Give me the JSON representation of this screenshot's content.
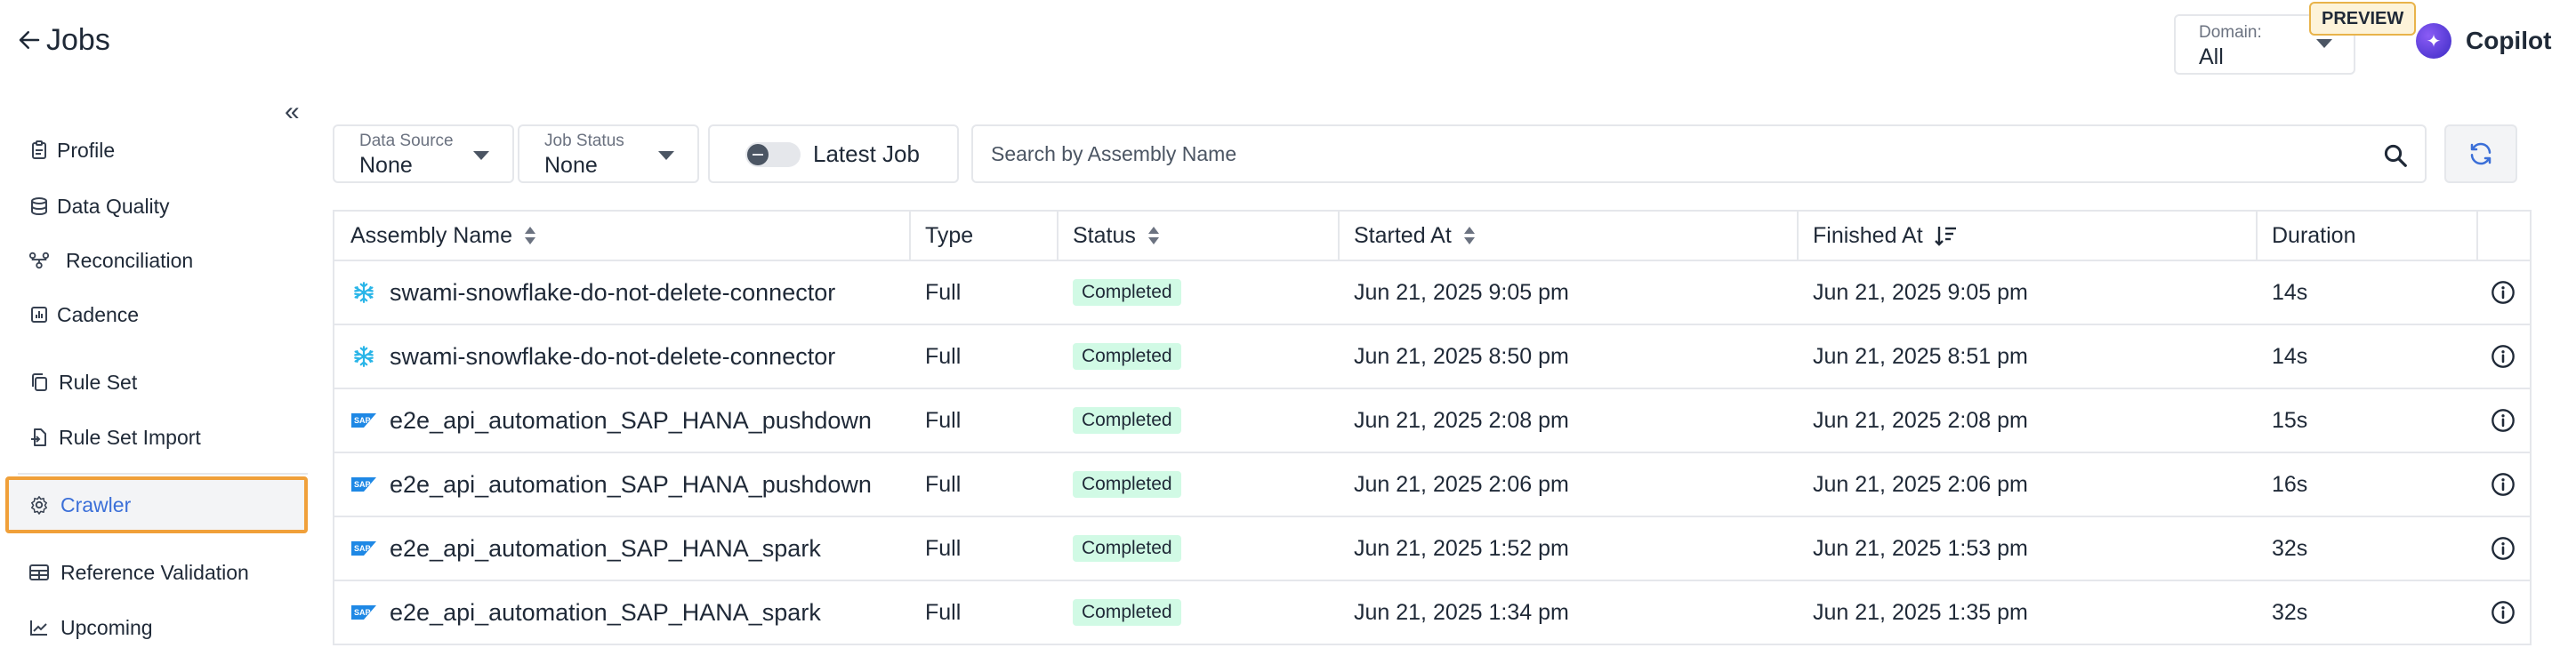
{
  "header": {
    "title": "Jobs",
    "domain": {
      "label": "Domain:",
      "value": "All"
    },
    "preview_badge": "PREVIEW",
    "copilot_label": "Copilot"
  },
  "sidebar": {
    "items": [
      {
        "label": "Profile",
        "icon": "clipboard-icon"
      },
      {
        "label": "Data Quality",
        "icon": "database-icon"
      },
      {
        "label": "Reconciliation",
        "icon": "reconciliation-icon"
      },
      {
        "label": "Cadence",
        "icon": "bar-chart-icon"
      },
      {
        "label": "Rule Set",
        "icon": "copy-icon"
      },
      {
        "label": "Rule Set Import",
        "icon": "file-import-icon"
      },
      {
        "label": "Crawler",
        "icon": "gear-icon",
        "active": true
      },
      {
        "label": "Reference Validation",
        "icon": "table-icon"
      },
      {
        "label": "Upcoming",
        "icon": "line-chart-icon"
      }
    ]
  },
  "filters": {
    "data_source": {
      "label": "Data Source",
      "value": "None"
    },
    "job_status": {
      "label": "Job Status",
      "value": "None"
    },
    "latest_job_label": "Latest Job",
    "latest_job_on": false,
    "search_placeholder": "Search by Assembly Name"
  },
  "table": {
    "columns": [
      "Assembly Name",
      "Type",
      "Status",
      "Started At",
      "Finished At",
      "Duration"
    ],
    "rows": [
      {
        "assembly": "swami-snowflake-do-not-delete-connector",
        "source": "snowflake",
        "type": "Full",
        "status": "Completed",
        "started": "Jun 21, 2025 9:05 pm",
        "finished": "Jun 21, 2025 9:05 pm",
        "duration": "14s"
      },
      {
        "assembly": "swami-snowflake-do-not-delete-connector",
        "source": "snowflake",
        "type": "Full",
        "status": "Completed",
        "started": "Jun 21, 2025 8:50 pm",
        "finished": "Jun 21, 2025 8:51 pm",
        "duration": "14s"
      },
      {
        "assembly": "e2e_api_automation_SAP_HANA_pushdown",
        "source": "sap",
        "type": "Full",
        "status": "Completed",
        "started": "Jun 21, 2025 2:08 pm",
        "finished": "Jun 21, 2025 2:08 pm",
        "duration": "15s"
      },
      {
        "assembly": "e2e_api_automation_SAP_HANA_pushdown",
        "source": "sap",
        "type": "Full",
        "status": "Completed",
        "started": "Jun 21, 2025 2:06 pm",
        "finished": "Jun 21, 2025 2:06 pm",
        "duration": "16s"
      },
      {
        "assembly": "e2e_api_automation_SAP_HANA_spark",
        "source": "sap",
        "type": "Full",
        "status": "Completed",
        "started": "Jun 21, 2025 1:52 pm",
        "finished": "Jun 21, 2025 1:53 pm",
        "duration": "32s"
      },
      {
        "assembly": "e2e_api_automation_SAP_HANA_spark",
        "source": "sap",
        "type": "Full",
        "status": "Completed",
        "started": "Jun 21, 2025 1:34 pm",
        "finished": "Jun 21, 2025 1:35 pm",
        "duration": "32s"
      }
    ]
  },
  "colors": {
    "accent": "#3b6fd8",
    "active_border": "#f0a03a",
    "status_completed_bg": "#d1fae5",
    "border": "#e5e7eb"
  }
}
